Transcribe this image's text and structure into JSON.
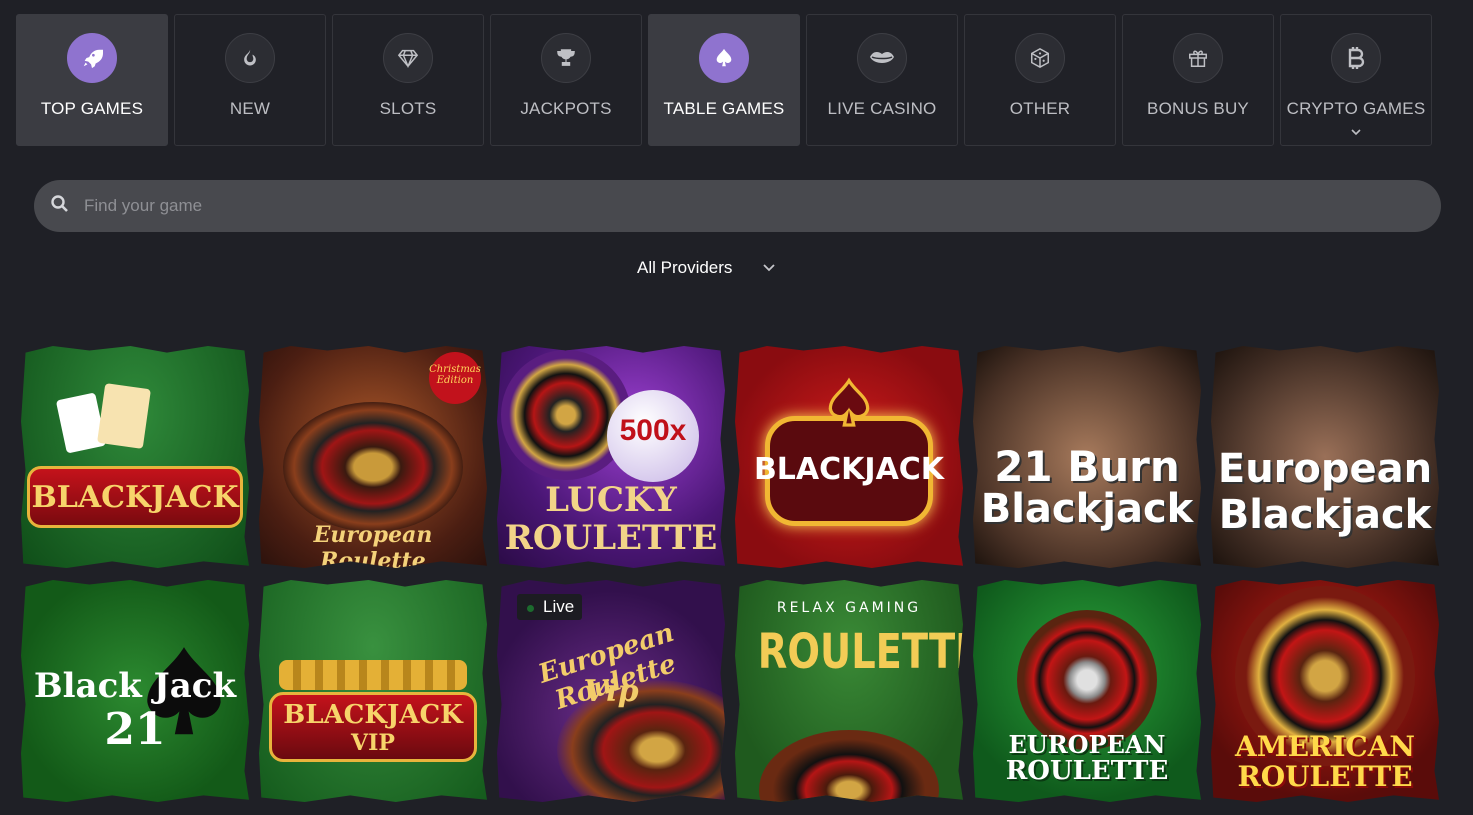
{
  "categories": [
    {
      "label": "TOP GAMES",
      "icon": "rocket-icon",
      "active": true
    },
    {
      "label": "NEW",
      "icon": "flame-icon",
      "active": false
    },
    {
      "label": "SLOTS",
      "icon": "diamond-icon",
      "active": false
    },
    {
      "label": "JACKPOTS",
      "icon": "trophy-icon",
      "active": false
    },
    {
      "label": "TABLE GAMES",
      "icon": "spade-icon",
      "active": true
    },
    {
      "label": "LIVE CASINO",
      "icon": "lips-icon",
      "active": false
    },
    {
      "label": "OTHER",
      "icon": "dice-icon",
      "active": false
    },
    {
      "label": "BONUS BUY",
      "icon": "gift-icon",
      "active": false
    },
    {
      "label": "CRYPTO GAMES",
      "icon": "bitcoin-icon",
      "active": false
    }
  ],
  "search": {
    "placeholder": "Find your game"
  },
  "providers": {
    "label": "All Providers"
  },
  "games": [
    {
      "line1": "BLACKJACK",
      "line2": "",
      "badge": "",
      "bg": "#1f6b2a"
    },
    {
      "line1": "European Roulette",
      "line2": "",
      "badge": "Christmas Edition",
      "bg": "#7a2e1c"
    },
    {
      "line1": "LUCKY",
      "line2": "ROULETTE",
      "badge": "500x",
      "bg": "#5b1f86"
    },
    {
      "line1": "BLACKJACK",
      "line2": "",
      "badge": "",
      "bg": "#a8101a"
    },
    {
      "line1": "21 Burn",
      "line2": "Blackjack",
      "badge": "",
      "bg": "#4a3226"
    },
    {
      "line1": "European",
      "line2": "Blackjack",
      "badge": "",
      "bg": "#3e2b22"
    },
    {
      "line1": "Black Jack",
      "line2": "21",
      "badge": "",
      "bg": "#1e6a22"
    },
    {
      "line1": "BLACKJACK",
      "line2": "VIP",
      "badge": "",
      "bg": "#256b2c"
    },
    {
      "line1": "European Roulette",
      "line2": "Vip",
      "badge": "Live",
      "bg": "#4b1f6b"
    },
    {
      "line1": "ROULETTE",
      "line2": "",
      "badge": "RELAX GAMING",
      "bg": "#2f6b2e"
    },
    {
      "line1": "EUROPEAN",
      "line2": "ROULETTE",
      "badge": "",
      "bg": "#1f7a2f"
    },
    {
      "line1": "AMERICAN",
      "line2": "ROULETTE",
      "badge": "",
      "bg": "#7a1410"
    }
  ]
}
